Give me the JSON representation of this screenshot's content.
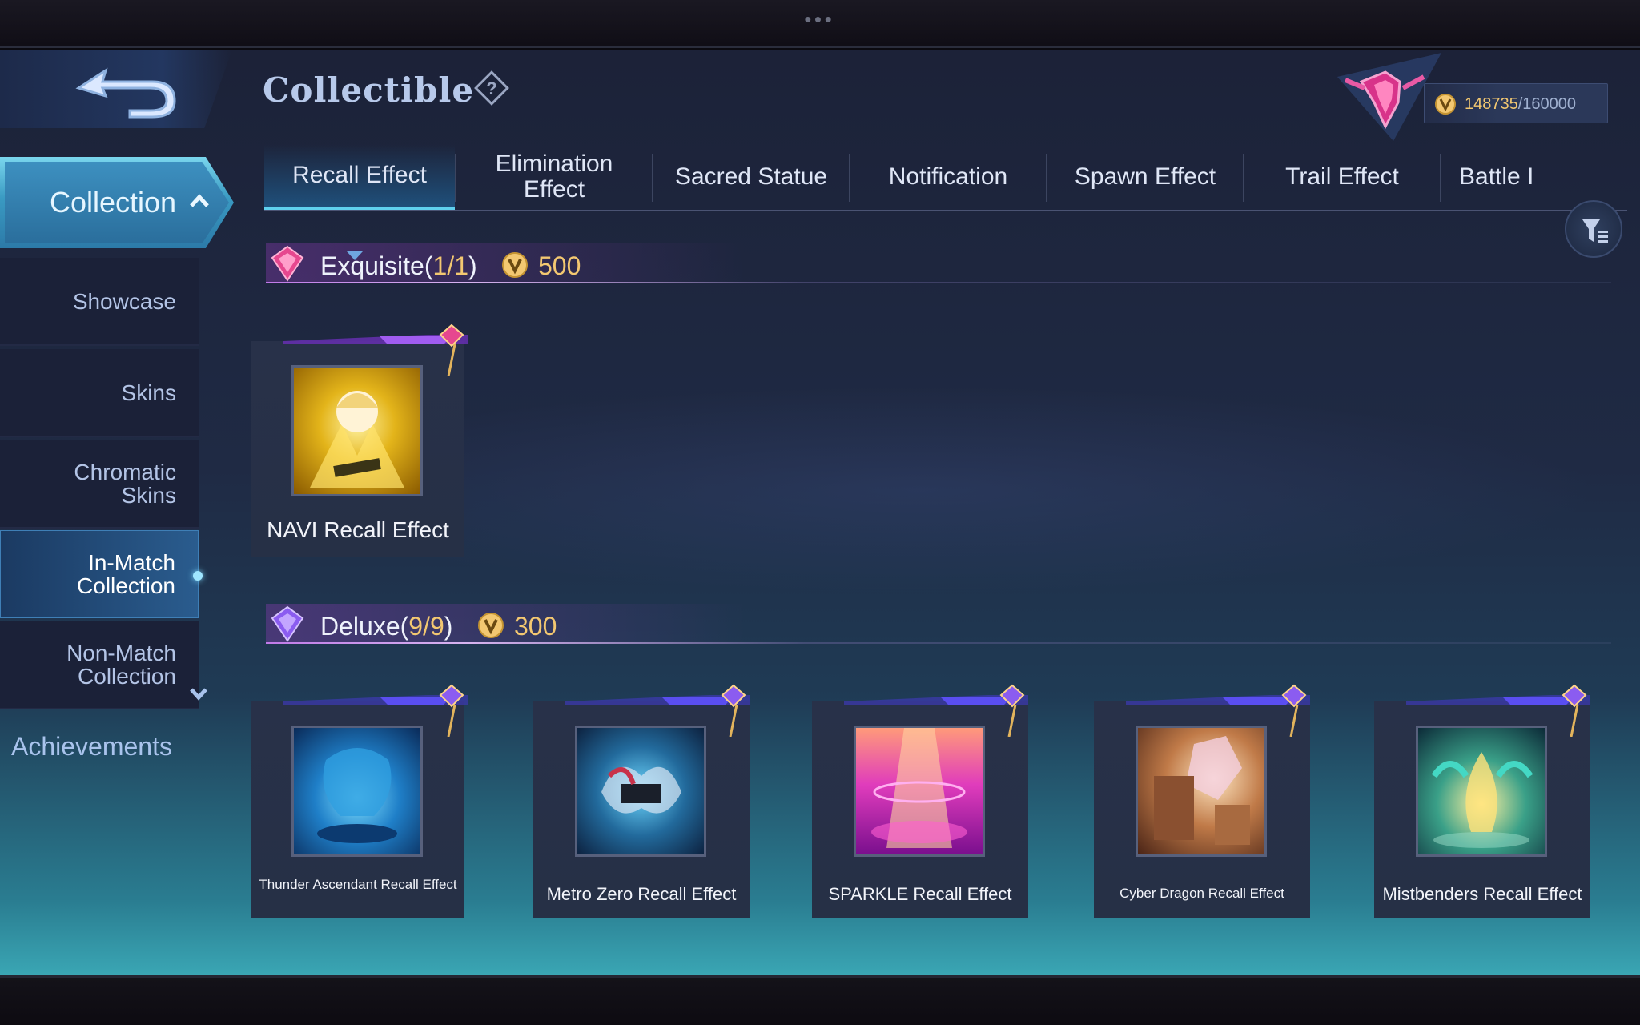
{
  "header": {
    "title": "Collectible",
    "points_current": "148735",
    "points_total": "/160000"
  },
  "sidebar": {
    "collection_label": "Collection",
    "items": [
      {
        "label": "Showcase",
        "active": false
      },
      {
        "label": "Skins",
        "active": false
      },
      {
        "label": "Chromatic Skins",
        "active": false
      },
      {
        "label": "In-Match Collection",
        "active": true
      },
      {
        "label": "Non-Match Collection",
        "active": false
      }
    ],
    "achievements_label": "Achievements"
  },
  "tabs": [
    {
      "label": "Recall Effect",
      "active": true
    },
    {
      "label": "Elimination Effect",
      "active": false
    },
    {
      "label": "Sacred Statue",
      "active": false
    },
    {
      "label": "Notification",
      "active": false
    },
    {
      "label": "Spawn Effect",
      "active": false
    },
    {
      "label": "Trail Effect",
      "active": false
    },
    {
      "label": "Battle I",
      "active": false
    }
  ],
  "sections": [
    {
      "tier": "Exquisite",
      "count": "1/1",
      "price": "500",
      "items": [
        {
          "name": "NAVI Recall Effect"
        }
      ]
    },
    {
      "tier": "Deluxe",
      "count": "9/9",
      "price": "300",
      "items": [
        {
          "name": "Thunder Ascendant Recall Effect"
        },
        {
          "name": "Metro Zero Recall Effect"
        },
        {
          "name": "SPARKLE Recall Effect"
        },
        {
          "name": "Cyber Dragon Recall Effect"
        },
        {
          "name": "Mistbenders Recall Effect"
        }
      ]
    }
  ],
  "colors": {
    "accent_cyan": "#5fd1ee",
    "gold": "#f3c871",
    "exquisite_pink": "#e6478f",
    "deluxe_purple": "#8b5cf0"
  }
}
